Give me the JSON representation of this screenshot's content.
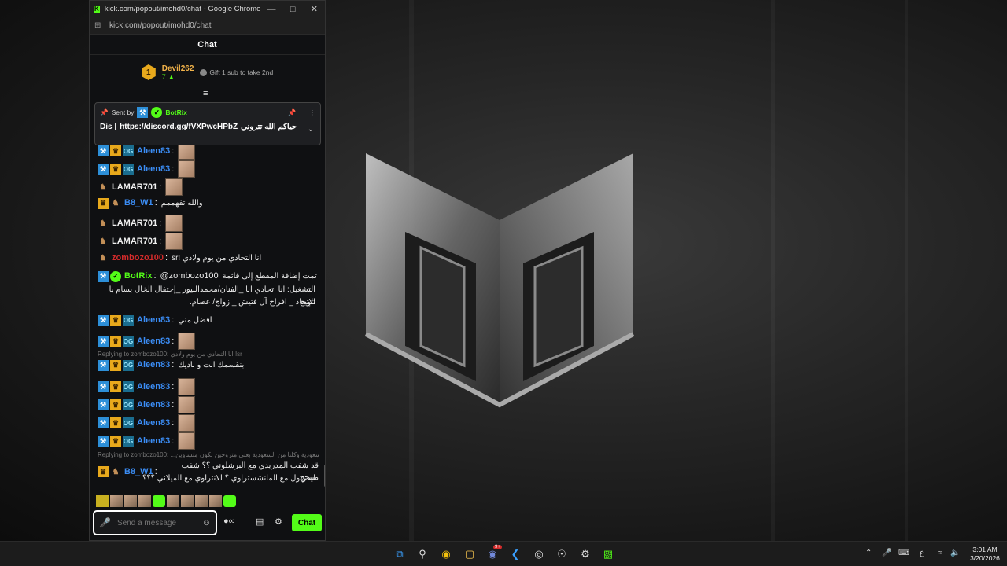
{
  "window": {
    "title": "kick.com/popout/imohd0/chat - Google Chrome",
    "url": "kick.com/popout/imohd0/chat"
  },
  "chat": {
    "header": "Chat",
    "leaderboard": {
      "rank": "1",
      "name": "Devil262",
      "count": "7",
      "gift_text": "Gift 1 sub to take 2nd"
    },
    "pinned": {
      "sent_by": "Sent by",
      "bot_name": "BotRix",
      "text_prefix": "Dis |",
      "link": "https://discord.gg/fVXPwcHPbZ",
      "text_suffix": "حياكم الله تتروني"
    },
    "messages": [
      {
        "user": "Aleen83",
        "text": ""
      },
      {
        "user": "Aleen83",
        "text": ""
      },
      {
        "user": "LAMAR701",
        "text": ""
      },
      {
        "user": "B8_W1",
        "text": "والله تفهممم"
      },
      {
        "user": "LAMAR701",
        "text": ""
      },
      {
        "user": "LAMAR701",
        "text": ""
      },
      {
        "user": "zombozo100",
        "text": "انا التحادي من يوم ولادي !sr"
      },
      {
        "user": "BotRix",
        "mention": "@zombozo100",
        "text": "تمت إضافة المقطع إلى قائمة",
        "line2": "التشغيل: انا اتحادي انا _الفنان/محمدالبيور _إحتفال الخال بسام با تتويج",
        "line3": "الإتحاد _ افراح آل فتيش _ زواج/ عصام."
      },
      {
        "user": "Aleen83",
        "text": "افضل مني"
      },
      {
        "user": "Aleen83",
        "text": ""
      },
      {
        "reply": "Replying to zombozo100: انا التحادي من يوم ولادي !sr",
        "user": "Aleen83",
        "text": "بنقسمك انت و ناديك"
      },
      {
        "user": "Aleen83",
        "text": ""
      },
      {
        "user": "Aleen83",
        "text": ""
      },
      {
        "user": "Aleen83",
        "text": ""
      },
      {
        "user": "Aleen83",
        "text": ""
      },
      {
        "reply": "Replying to zombozo100: ...ي سعودية وكلنا من السعودية بعني متزوجين نكون متساوين",
        "user": "B8_W1",
        "text": "قد شفت المدريدي مع البرشلوني ؟؟ شفت متنحج",
        "line2": "ليفربول مع المانشستراوي ؟ الانتراوي مع الميلاني ؟؟؟"
      }
    ],
    "input": {
      "placeholder": "Send a message"
    },
    "chat_button": "Chat"
  },
  "taskbar": {
    "time": "3:01 AM",
    "date": "3/20/2026",
    "lang": "ع",
    "badge_count": "9+"
  },
  "colors": {
    "kick_green": "#53fc18",
    "gold": "#e8a91c",
    "mod_blue": "#2d8fd8"
  }
}
